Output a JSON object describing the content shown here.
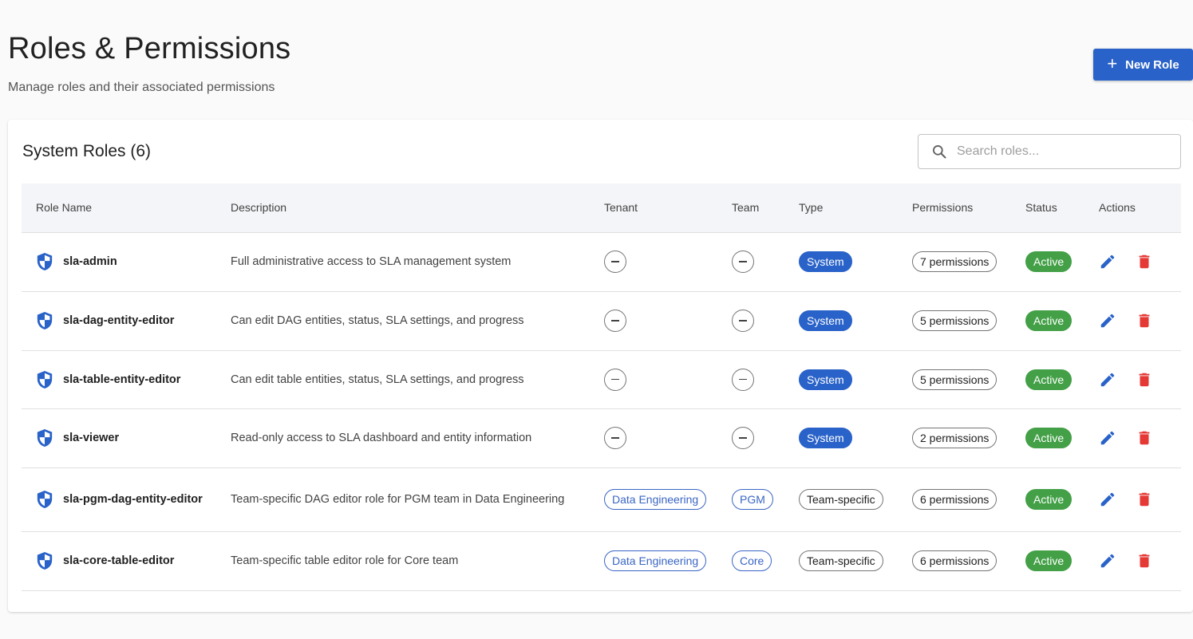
{
  "header": {
    "title": "Roles & Permissions",
    "subtitle": "Manage roles and their associated permissions",
    "new_role_label": "New Role"
  },
  "card": {
    "title": "System Roles (6)",
    "search_placeholder": "Search roles..."
  },
  "table": {
    "columns": [
      "Role Name",
      "Description",
      "Tenant",
      "Team",
      "Type",
      "Permissions",
      "Status",
      "Actions"
    ],
    "rows": [
      {
        "name": "sla-admin",
        "description": "Full administrative access to SLA management system",
        "tenant": null,
        "team": null,
        "type": "System",
        "permissions": "7 permissions",
        "status": "Active"
      },
      {
        "name": "sla-dag-entity-editor",
        "description": "Can edit DAG entities, status, SLA settings, and progress",
        "tenant": null,
        "team": null,
        "type": "System",
        "permissions": "5 permissions",
        "status": "Active"
      },
      {
        "name": "sla-table-entity-editor",
        "description": "Can edit table entities, status, SLA settings, and progress",
        "tenant": null,
        "team": null,
        "type": "System",
        "permissions": "5 permissions",
        "status": "Active"
      },
      {
        "name": "sla-viewer",
        "description": "Read-only access to SLA dashboard and entity information",
        "tenant": null,
        "team": null,
        "type": "System",
        "permissions": "2 permissions",
        "status": "Active"
      },
      {
        "name": "sla-pgm-dag-entity-editor",
        "description": "Team-specific DAG editor role for PGM team in Data Engineering",
        "tenant": "Data Engineering",
        "team": "PGM",
        "type": "Team-specific",
        "permissions": "6 permissions",
        "status": "Active"
      },
      {
        "name": "sla-core-table-editor",
        "description": "Team-specific table editor role for Core team",
        "tenant": "Data Engineering",
        "team": "Core",
        "type": "Team-specific",
        "permissions": "6 permissions",
        "status": "Active"
      }
    ]
  },
  "colors": {
    "primary": "#2962c8",
    "active": "#43a047",
    "delete": "#e53935"
  },
  "icons": {
    "new_role": "plus-icon",
    "search": "search-icon",
    "role": "shield-icon",
    "edit": "pencil-icon",
    "delete": "trash-icon",
    "none": "dash-icon"
  }
}
